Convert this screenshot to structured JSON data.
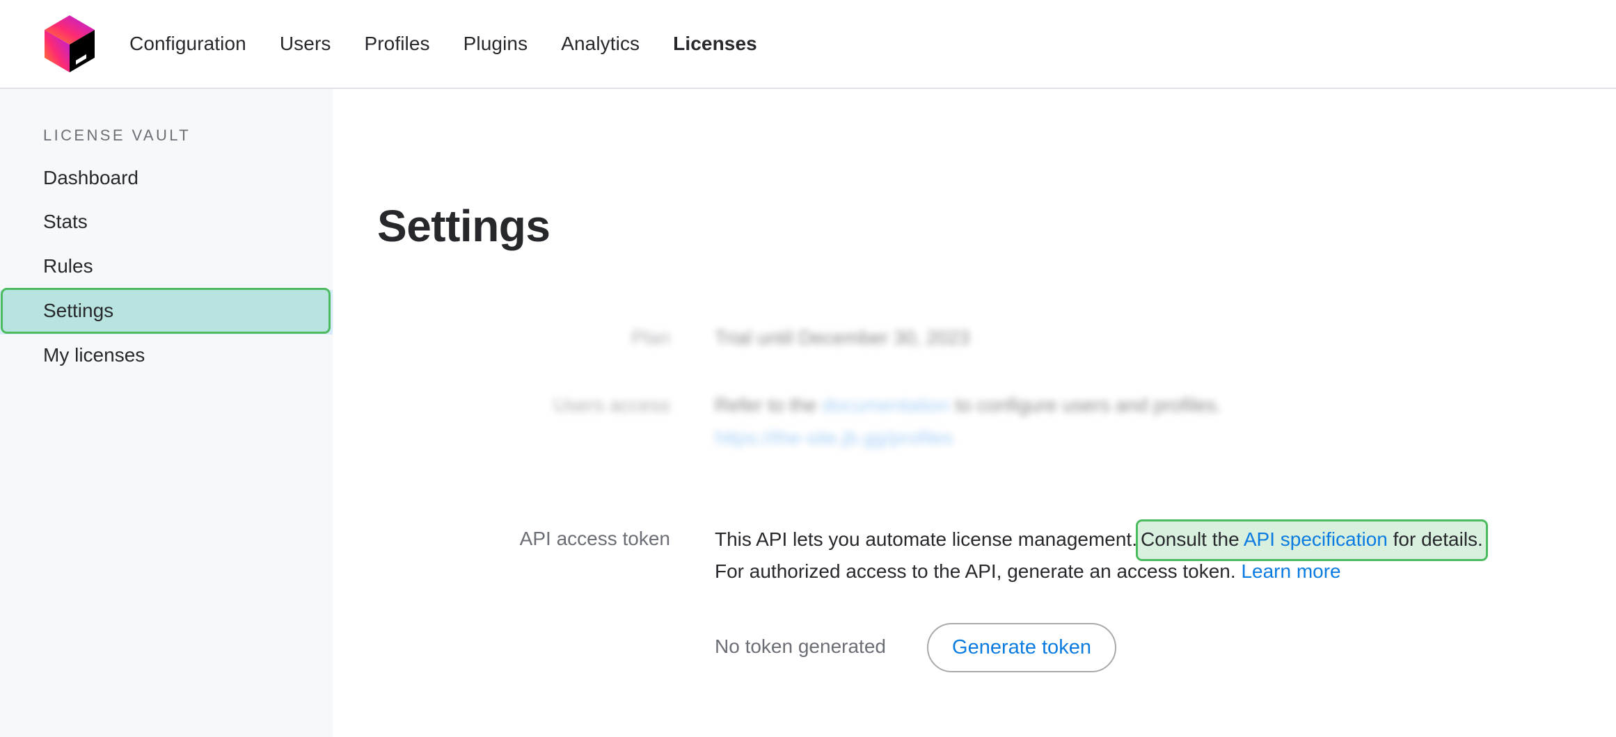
{
  "header": {
    "logo_icon": "product-cube-logo",
    "nav": [
      {
        "label": "Configuration",
        "active": false
      },
      {
        "label": "Users",
        "active": false
      },
      {
        "label": "Profiles",
        "active": false
      },
      {
        "label": "Plugins",
        "active": false
      },
      {
        "label": "Analytics",
        "active": false
      },
      {
        "label": "Licenses",
        "active": true
      }
    ]
  },
  "sidebar": {
    "heading": "LICENSE VAULT",
    "items": [
      {
        "label": "Dashboard",
        "selected": false
      },
      {
        "label": "Stats",
        "selected": false
      },
      {
        "label": "Rules",
        "selected": false
      },
      {
        "label": "Settings",
        "selected": true
      },
      {
        "label": "My licenses",
        "selected": false
      }
    ]
  },
  "main": {
    "title": "Settings",
    "plan": {
      "label": "Plan",
      "value": "Trial until December 30, 2023",
      "blurred": true
    },
    "users_access": {
      "label": "Users access",
      "text_before": "Refer to the ",
      "link_label": "documentation",
      "text_after": " to configure users and profiles.",
      "url_text": "https://the-site.jb.gg/profiles",
      "blurred": true
    },
    "api_token": {
      "label": "API access token",
      "line1_text": "This API lets you automate license management.",
      "callout_before": "Consult the ",
      "callout_link": "API specification",
      "callout_after": " for details.",
      "line2_text": "For authorized access to the API, generate an access token. ",
      "learn_more": "Learn more",
      "status": "No token generated",
      "generate_button": "Generate token"
    }
  },
  "colors": {
    "accent_link": "#0a7be0",
    "highlight_border": "#4cbb5f",
    "sidebar_highlight_fill": "#b8e3de",
    "callout_fill": "#d9f0df",
    "sidebar_bg": "#f7f8fa"
  }
}
